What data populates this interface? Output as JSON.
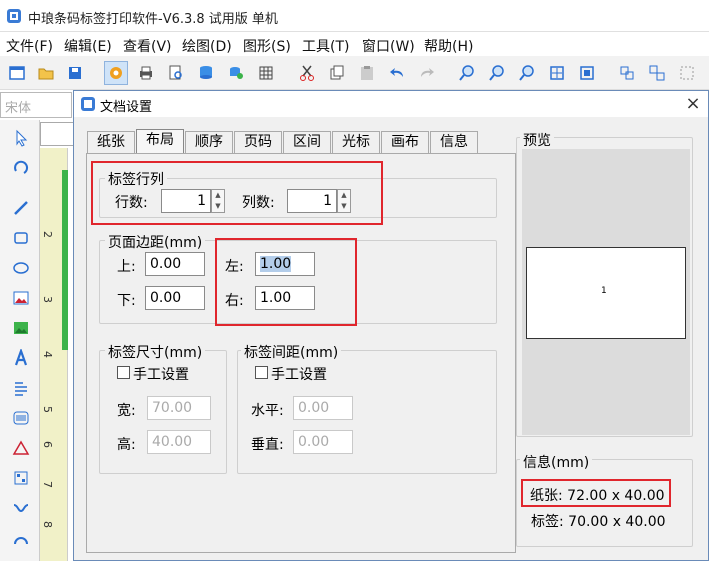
{
  "app": {
    "title": "中琅条码标签打印软件-V6.3.8 试用版 单机"
  },
  "menu": [
    "文件(F)",
    "编辑(E)",
    "查看(V)",
    "绘图(D)",
    "图形(S)",
    "工具(T)",
    "窗口(W)",
    "帮助(H)"
  ],
  "font_box": {
    "value": "宋体"
  },
  "ruler_numbers": [
    "2",
    "3",
    "4",
    "5",
    "6",
    "7",
    "8"
  ],
  "dialog": {
    "title": "文档设置",
    "close": "×",
    "tabs": [
      "纸张",
      "布局",
      "顺序",
      "页码",
      "区间",
      "光标",
      "画布",
      "信息"
    ],
    "active_tab": "布局",
    "rows_cols": {
      "legend": "标签行列",
      "rows_label": "行数:",
      "rows_value": "1",
      "cols_label": "列数:",
      "cols_value": "1"
    },
    "margins": {
      "legend": "页面边距(mm)",
      "top_label": "上:",
      "top_value": "0.00",
      "bottom_label": "下:",
      "bottom_value": "0.00",
      "left_label": "左:",
      "left_value": "1.00",
      "right_label": "右:",
      "right_value": "1.00"
    },
    "label_size": {
      "legend": "标签尺寸(mm)",
      "manual_label": "手工设置",
      "width_label": "宽:",
      "width_value": "70.00",
      "height_label": "高:",
      "height_value": "40.00"
    },
    "label_gap": {
      "legend": "标签间距(mm)",
      "manual_label": "手工设置",
      "horizontal_label": "水平:",
      "horizontal_value": "0.00",
      "vertical_label": "垂直:",
      "vertical_value": "0.00"
    },
    "preview": {
      "legend": "预览",
      "page_number": "1"
    },
    "info": {
      "legend": "信息(mm)",
      "paper_line": "纸张: 72.00 x 40.00",
      "label_line": "标签: 70.00 x 40.00"
    }
  },
  "colors": {
    "highlight_red": "#e0262d",
    "accent_blue": "#2a6fd1",
    "ruler_yellow": "#f1f1c8",
    "green_bar": "#3cb34a"
  }
}
